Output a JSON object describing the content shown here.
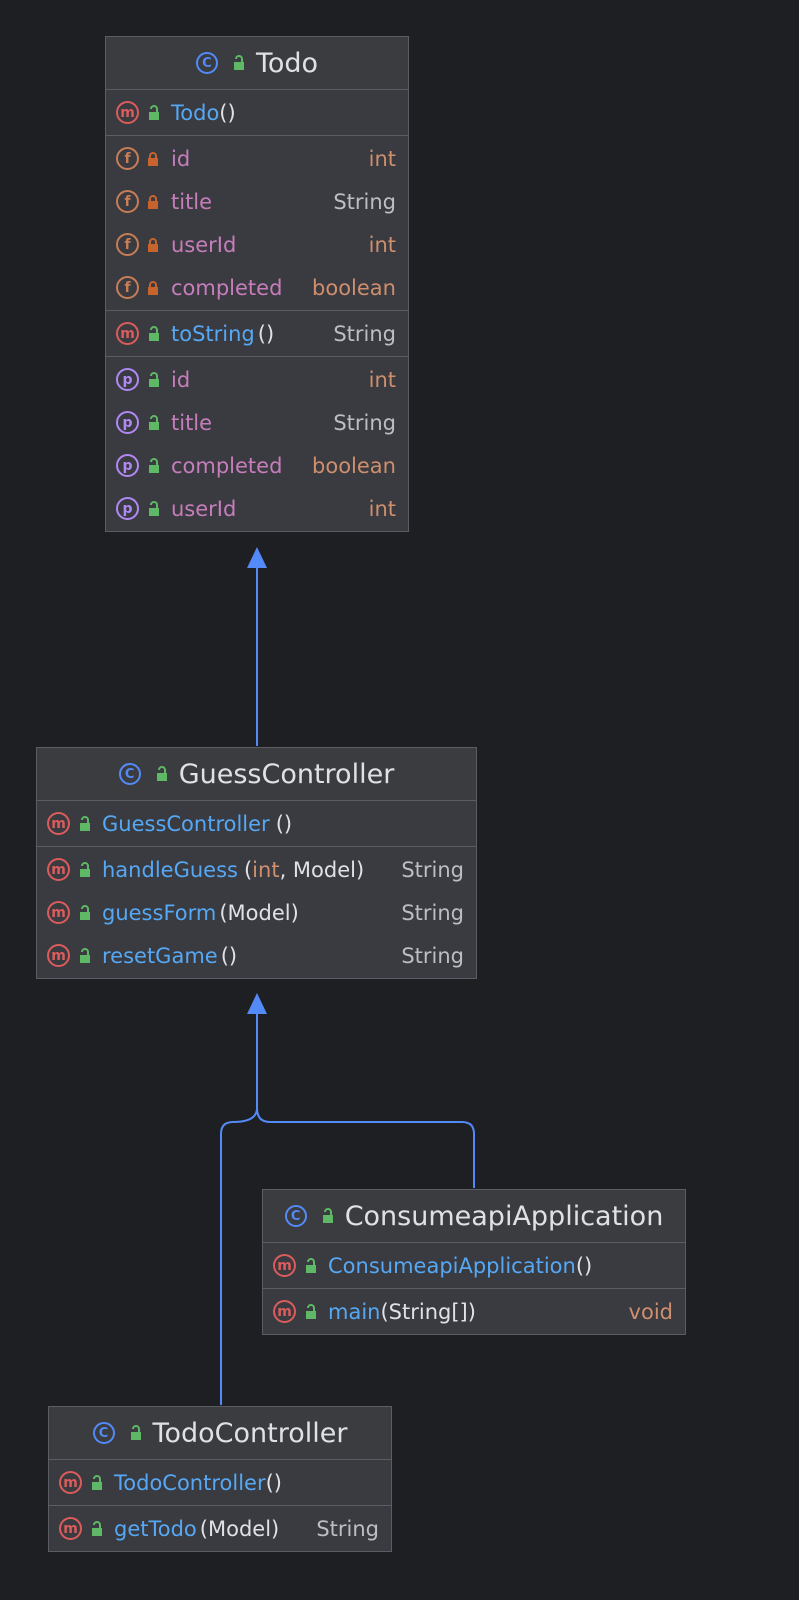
{
  "colors": {
    "background": "#1e1f22",
    "box": "#393b40",
    "border": "#5a5d63",
    "edge": "#548af7",
    "method_name": "#56a8f5",
    "field_name": "#c77dbb",
    "primitive_type": "#cf8e6d"
  },
  "icons": {
    "class": "class-icon",
    "method": "method-icon",
    "field": "field-icon",
    "property": "property-icon",
    "public": "unlocked-icon",
    "private": "locked-icon"
  },
  "todo": {
    "name": "Todo",
    "constructor": {
      "name": "Todo",
      "params": "()"
    },
    "fields": [
      {
        "name": "id",
        "type": "int"
      },
      {
        "name": "title",
        "type": "String"
      },
      {
        "name": "userId",
        "type": "int"
      },
      {
        "name": "completed",
        "type": "boolean"
      }
    ],
    "method": {
      "name": "toString",
      "params": "()",
      "type": "String"
    },
    "properties": [
      {
        "name": "id",
        "type": "int"
      },
      {
        "name": "title",
        "type": "String"
      },
      {
        "name": "completed",
        "type": "boolean"
      },
      {
        "name": "userId",
        "type": "int"
      }
    ]
  },
  "guess_controller": {
    "name": "GuessController",
    "constructor": {
      "name": "GuessController",
      "params": "()"
    },
    "methods": [
      {
        "name": "handleGuess",
        "params_open": "(",
        "params_prim": "int",
        "params_rest": ", Model)",
        "type": "String"
      },
      {
        "name": "guessForm",
        "params": "(Model)",
        "type": "String"
      },
      {
        "name": "resetGame",
        "params": "()",
        "type": "String"
      }
    ]
  },
  "consumeapi_application": {
    "name": "ConsumeapiApplication",
    "constructor": {
      "name": "ConsumeapiApplication",
      "params": "()"
    },
    "methods": [
      {
        "name": "main",
        "params": "(String[])",
        "type": "void"
      }
    ]
  },
  "todo_controller": {
    "name": "TodoController",
    "constructor": {
      "name": "TodoController",
      "params": "()"
    },
    "methods": [
      {
        "name": "getTodo",
        "params": "(Model)",
        "type": "String"
      }
    ]
  }
}
